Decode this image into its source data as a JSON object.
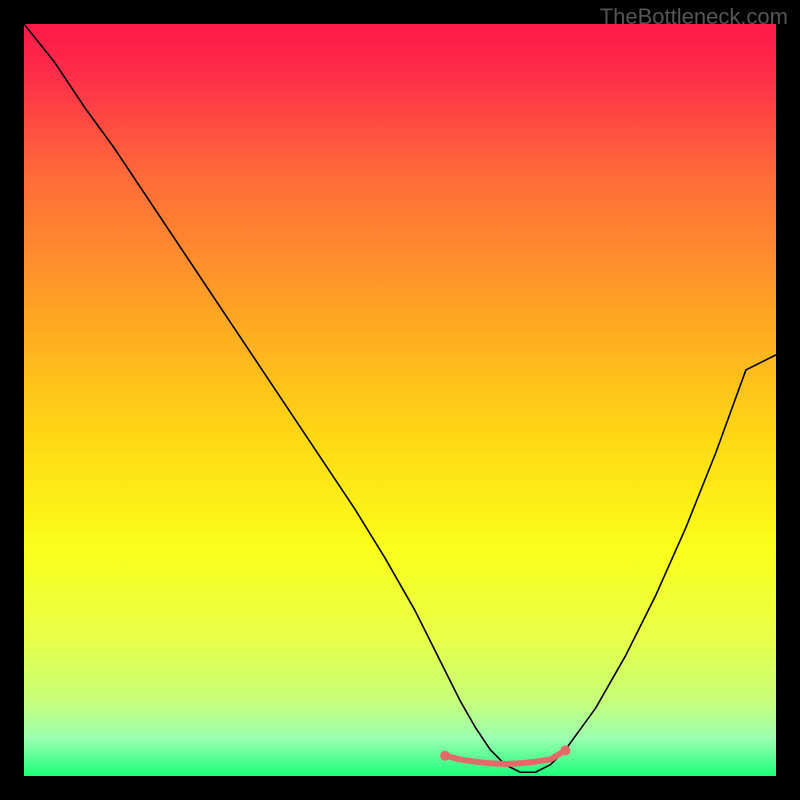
{
  "watermark": "TheBottleneck.com",
  "chart_data": {
    "type": "line",
    "title": "",
    "xlabel": "",
    "ylabel": "",
    "xlim": [
      0,
      100
    ],
    "ylim": [
      0,
      100
    ],
    "background_gradient": {
      "stops": [
        {
          "offset": 0.0,
          "color": "#ff1a4a"
        },
        {
          "offset": 0.06,
          "color": "#ff2a4a"
        },
        {
          "offset": 0.2,
          "color": "#ff6a3a"
        },
        {
          "offset": 0.38,
          "color": "#ffa324"
        },
        {
          "offset": 0.55,
          "color": "#ffd814"
        },
        {
          "offset": 0.7,
          "color": "#faff1a"
        },
        {
          "offset": 0.82,
          "color": "#e7ff4a"
        },
        {
          "offset": 0.9,
          "color": "#c6ff7a"
        },
        {
          "offset": 0.95,
          "color": "#9bffb0"
        },
        {
          "offset": 1.0,
          "color": "#1aff7a"
        }
      ]
    },
    "series": [
      {
        "name": "bottleneck-curve",
        "color": "#000000",
        "width": 1.6,
        "x": [
          0,
          4,
          8,
          12,
          16,
          20,
          24,
          28,
          32,
          36,
          40,
          44,
          48,
          52,
          54,
          56,
          58,
          60,
          62,
          64,
          66,
          68,
          70,
          72,
          76,
          80,
          84,
          88,
          92,
          96,
          100
        ],
        "y": [
          100,
          95,
          89,
          83.5,
          77.5,
          71.5,
          65.5,
          59.5,
          53.5,
          47.5,
          41.5,
          35.5,
          29,
          22,
          18,
          14,
          10,
          6.5,
          3.5,
          1.5,
          0.5,
          0.5,
          1.5,
          3.5,
          9,
          16,
          24,
          33,
          43,
          54,
          56
        ]
      },
      {
        "name": "bottom-highlight",
        "type": "scatter-line",
        "color": "#e46a6a",
        "width": 6,
        "point_r": 5,
        "x": [
          56,
          58,
          60,
          62,
          64,
          66,
          68,
          70,
          72
        ],
        "y": [
          2.7,
          2.2,
          1.9,
          1.7,
          1.6,
          1.7,
          1.9,
          2.2,
          3.4
        ]
      }
    ]
  }
}
